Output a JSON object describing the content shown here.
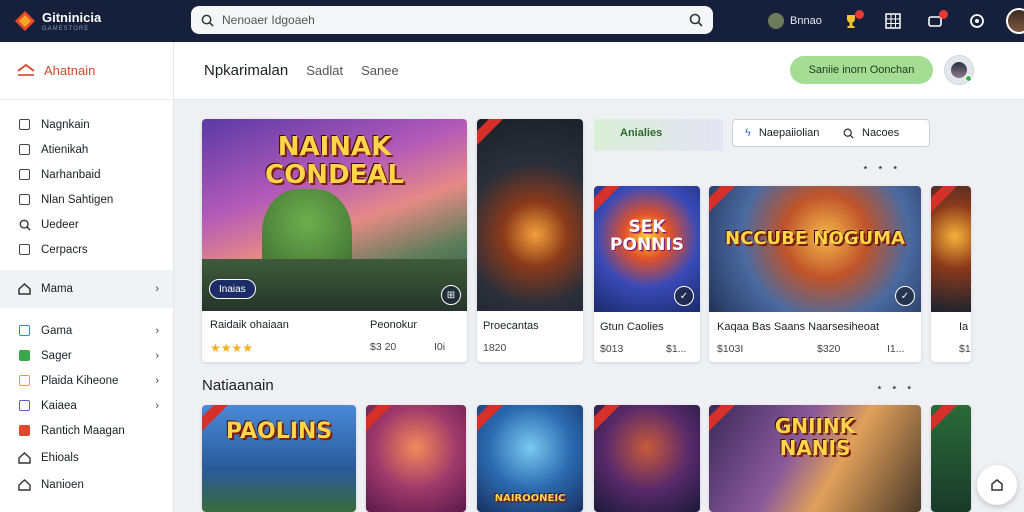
{
  "topbar": {
    "brand_name": "Gitninicia",
    "brand_sub": "GAMESTORE",
    "search_placeholder": "Nenoaer Idgoaeh",
    "user_name": "Bnnao"
  },
  "sidebar": {
    "header_label": "Ahatnain",
    "items": [
      {
        "label": "Nagnkain",
        "icon": "gamepad-icon"
      },
      {
        "label": "Atienikah",
        "icon": "document-icon"
      },
      {
        "label": "Narhanbaid",
        "icon": "mail-icon"
      },
      {
        "label": "Nlan Sahtigen",
        "icon": "clipboard-icon"
      },
      {
        "label": "Uedeer",
        "icon": "search-icon"
      },
      {
        "label": "Cerpacrs",
        "icon": "list-icon"
      }
    ],
    "active": {
      "label": "Mama",
      "icon": "home-icon"
    },
    "sub_items": [
      {
        "label": "Gama",
        "icon": "home-icon",
        "color": "#3a86c8"
      },
      {
        "label": "Sager",
        "icon": "tag-icon",
        "color": "#3aa84a"
      },
      {
        "label": "Plaida Kiheone",
        "icon": "box-icon",
        "color": "#f0a020"
      },
      {
        "label": "Kaiaea",
        "icon": "square-icon",
        "color": "#5b5bd6"
      },
      {
        "label": "Rantich Maagan",
        "icon": "flag-icon",
        "color": "#e0482e"
      },
      {
        "label": "Ehioals",
        "icon": "home-icon",
        "color": "#333333"
      },
      {
        "label": "Nanioen",
        "icon": "home-icon",
        "color": "#333333"
      }
    ]
  },
  "main": {
    "title": "Npkarimalan",
    "tabs": [
      "Sadlat",
      "Sanee"
    ],
    "cta_label": "Saniie inorn Oonchan",
    "filter": {
      "left": "Naepaiiolian",
      "right": "Nacoes"
    },
    "section_title": "Natiaanain"
  },
  "featured": {
    "art_title": "NAINAK CONDEAL",
    "pill_label": "Inaias",
    "name_left": "Raidaik ohaiaan",
    "name_right": "Peonokur",
    "rating": "★★★★",
    "price_left": "$3 20",
    "price_right": "I0i"
  },
  "cards": [
    {
      "name": "Proecantas",
      "price_left": "1820",
      "price_right": ""
    },
    {
      "art_title": "SEK PONNIS",
      "name": "Gtun Caolies",
      "price_left": "$013",
      "price_right": "$1..."
    },
    {
      "art_title": "NCCUBE NOGUMA",
      "name": "Kaqaa Bas Saans  Naarsesiheoat",
      "price_left": "$103I",
      "price_right": "$320",
      "price_extra": "I1..."
    },
    {
      "name": "Ia",
      "price_left": "",
      "price_right": "$1"
    }
  ],
  "banner": {
    "label": "Anialies"
  },
  "row2": [
    {
      "art_title": "PAOLINS"
    },
    {
      "art_title": ""
    },
    {
      "art_title": "NAIROONEIC"
    },
    {
      "art_title": ""
    },
    {
      "art_title": "GNIINK NANIS"
    },
    {
      "art_title": ""
    }
  ]
}
